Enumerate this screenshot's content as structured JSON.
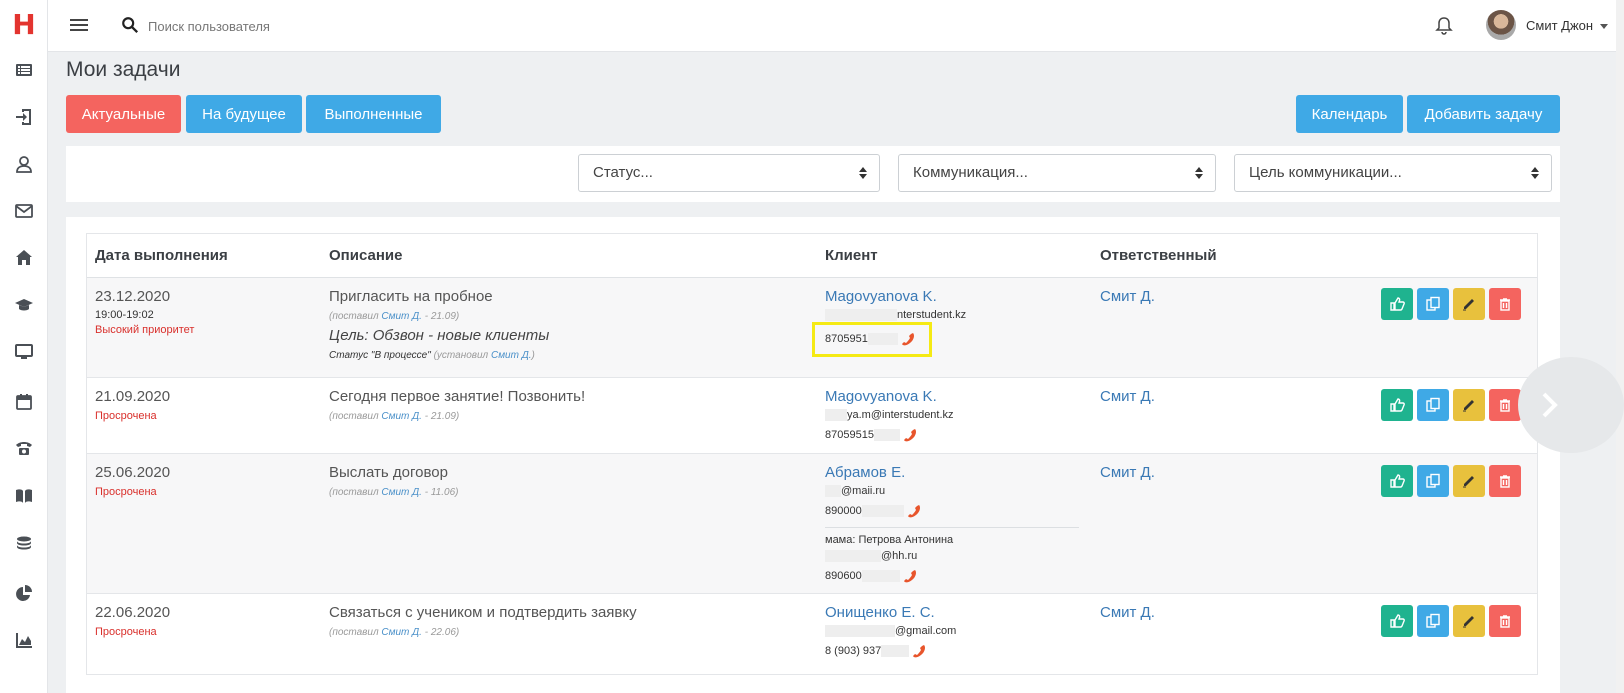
{
  "app": {
    "logo": "H"
  },
  "sidebar": {
    "items": [
      {
        "icon": "list-icon"
      },
      {
        "icon": "login-icon"
      },
      {
        "icon": "user-icon"
      },
      {
        "icon": "mail-icon"
      },
      {
        "icon": "home-icon"
      },
      {
        "icon": "graduation-cap-icon"
      },
      {
        "icon": "monitor-icon"
      },
      {
        "icon": "calendar-icon"
      },
      {
        "icon": "phone-icon"
      },
      {
        "icon": "book-icon"
      },
      {
        "icon": "coins-icon"
      },
      {
        "icon": "pie-chart-icon"
      },
      {
        "icon": "area-chart-icon"
      }
    ]
  },
  "header": {
    "search_placeholder": "Поиск пользователя",
    "user_name": "Смит Джон"
  },
  "page": {
    "title": "Мои задачи",
    "tabs": {
      "actual": "Актуальные",
      "future": "На будущее",
      "done": "Выполненные"
    },
    "calendar_button": "Календарь",
    "add_button": "Добавить задачу"
  },
  "filters": {
    "status": "Статус...",
    "communication": "Коммуникация...",
    "goal": "Цель коммуникации..."
  },
  "table": {
    "headers": {
      "date": "Дата выполнения",
      "description": "Описание",
      "client": "Клиент",
      "responsible": "Ответственный"
    },
    "rows": [
      {
        "date": "23.12.2020",
        "time": "19:00-19:02",
        "flag": "Высокий приоритет",
        "description": "Пригласить на пробное",
        "meta_prefix": "(поставил",
        "meta_author": "Смит Д.",
        "meta_suffix": "- 21.09)",
        "goal": "Цель: Обзвон - новые клиенты",
        "status_text": "Статус \"В процессе\"",
        "status_prefix": "(установил",
        "status_author": "Смит Д.",
        "status_suffix": ")",
        "client_name": "Magovyanova K.",
        "email_visible": "nterstudent.kz",
        "phone_visible": "8705951",
        "responsible": "Смит Д."
      },
      {
        "date": "21.09.2020",
        "flag": "Просрочена",
        "description": "Сегодня первое занятие! Позвонить!",
        "meta_prefix": "(поставил",
        "meta_author": "Смит Д.",
        "meta_suffix": "- 21.09)",
        "client_name": "Magovyanova K.",
        "email_visible": "ya.m@interstudent.kz",
        "phone_visible": "87059515",
        "responsible": "Смит Д."
      },
      {
        "date": "25.06.2020",
        "flag": "Просрочена",
        "description": "Выслать договор",
        "meta_prefix": "(поставил",
        "meta_author": "Смит Д.",
        "meta_suffix": "- 11.06)",
        "client_name": "Абрамов Е.",
        "email_visible": "@maii.ru",
        "phone_visible": "890000",
        "relative_label": "мама: Петрова Антонина",
        "relative_email_visible": "@hh.ru",
        "relative_phone_visible": "890600",
        "responsible": "Смит Д."
      },
      {
        "date": "22.06.2020",
        "flag": "Просрочена",
        "description": "Связаться с учеником и подтвердить заявку",
        "meta_prefix": "(поставил",
        "meta_author": "Смит Д.",
        "meta_suffix": "- 22.06)",
        "client_name": "Онищенко Е. С.",
        "email_visible": "@gmail.com",
        "phone_visible": "8 (903) 937",
        "responsible": "Смит Д."
      }
    ]
  },
  "colors": {
    "accent_red": "#f4645f",
    "accent_blue": "#3fa9e6",
    "approve_green": "#1fb38f",
    "edit_yellow": "#e8c13d",
    "highlight": "#f5ea14"
  }
}
